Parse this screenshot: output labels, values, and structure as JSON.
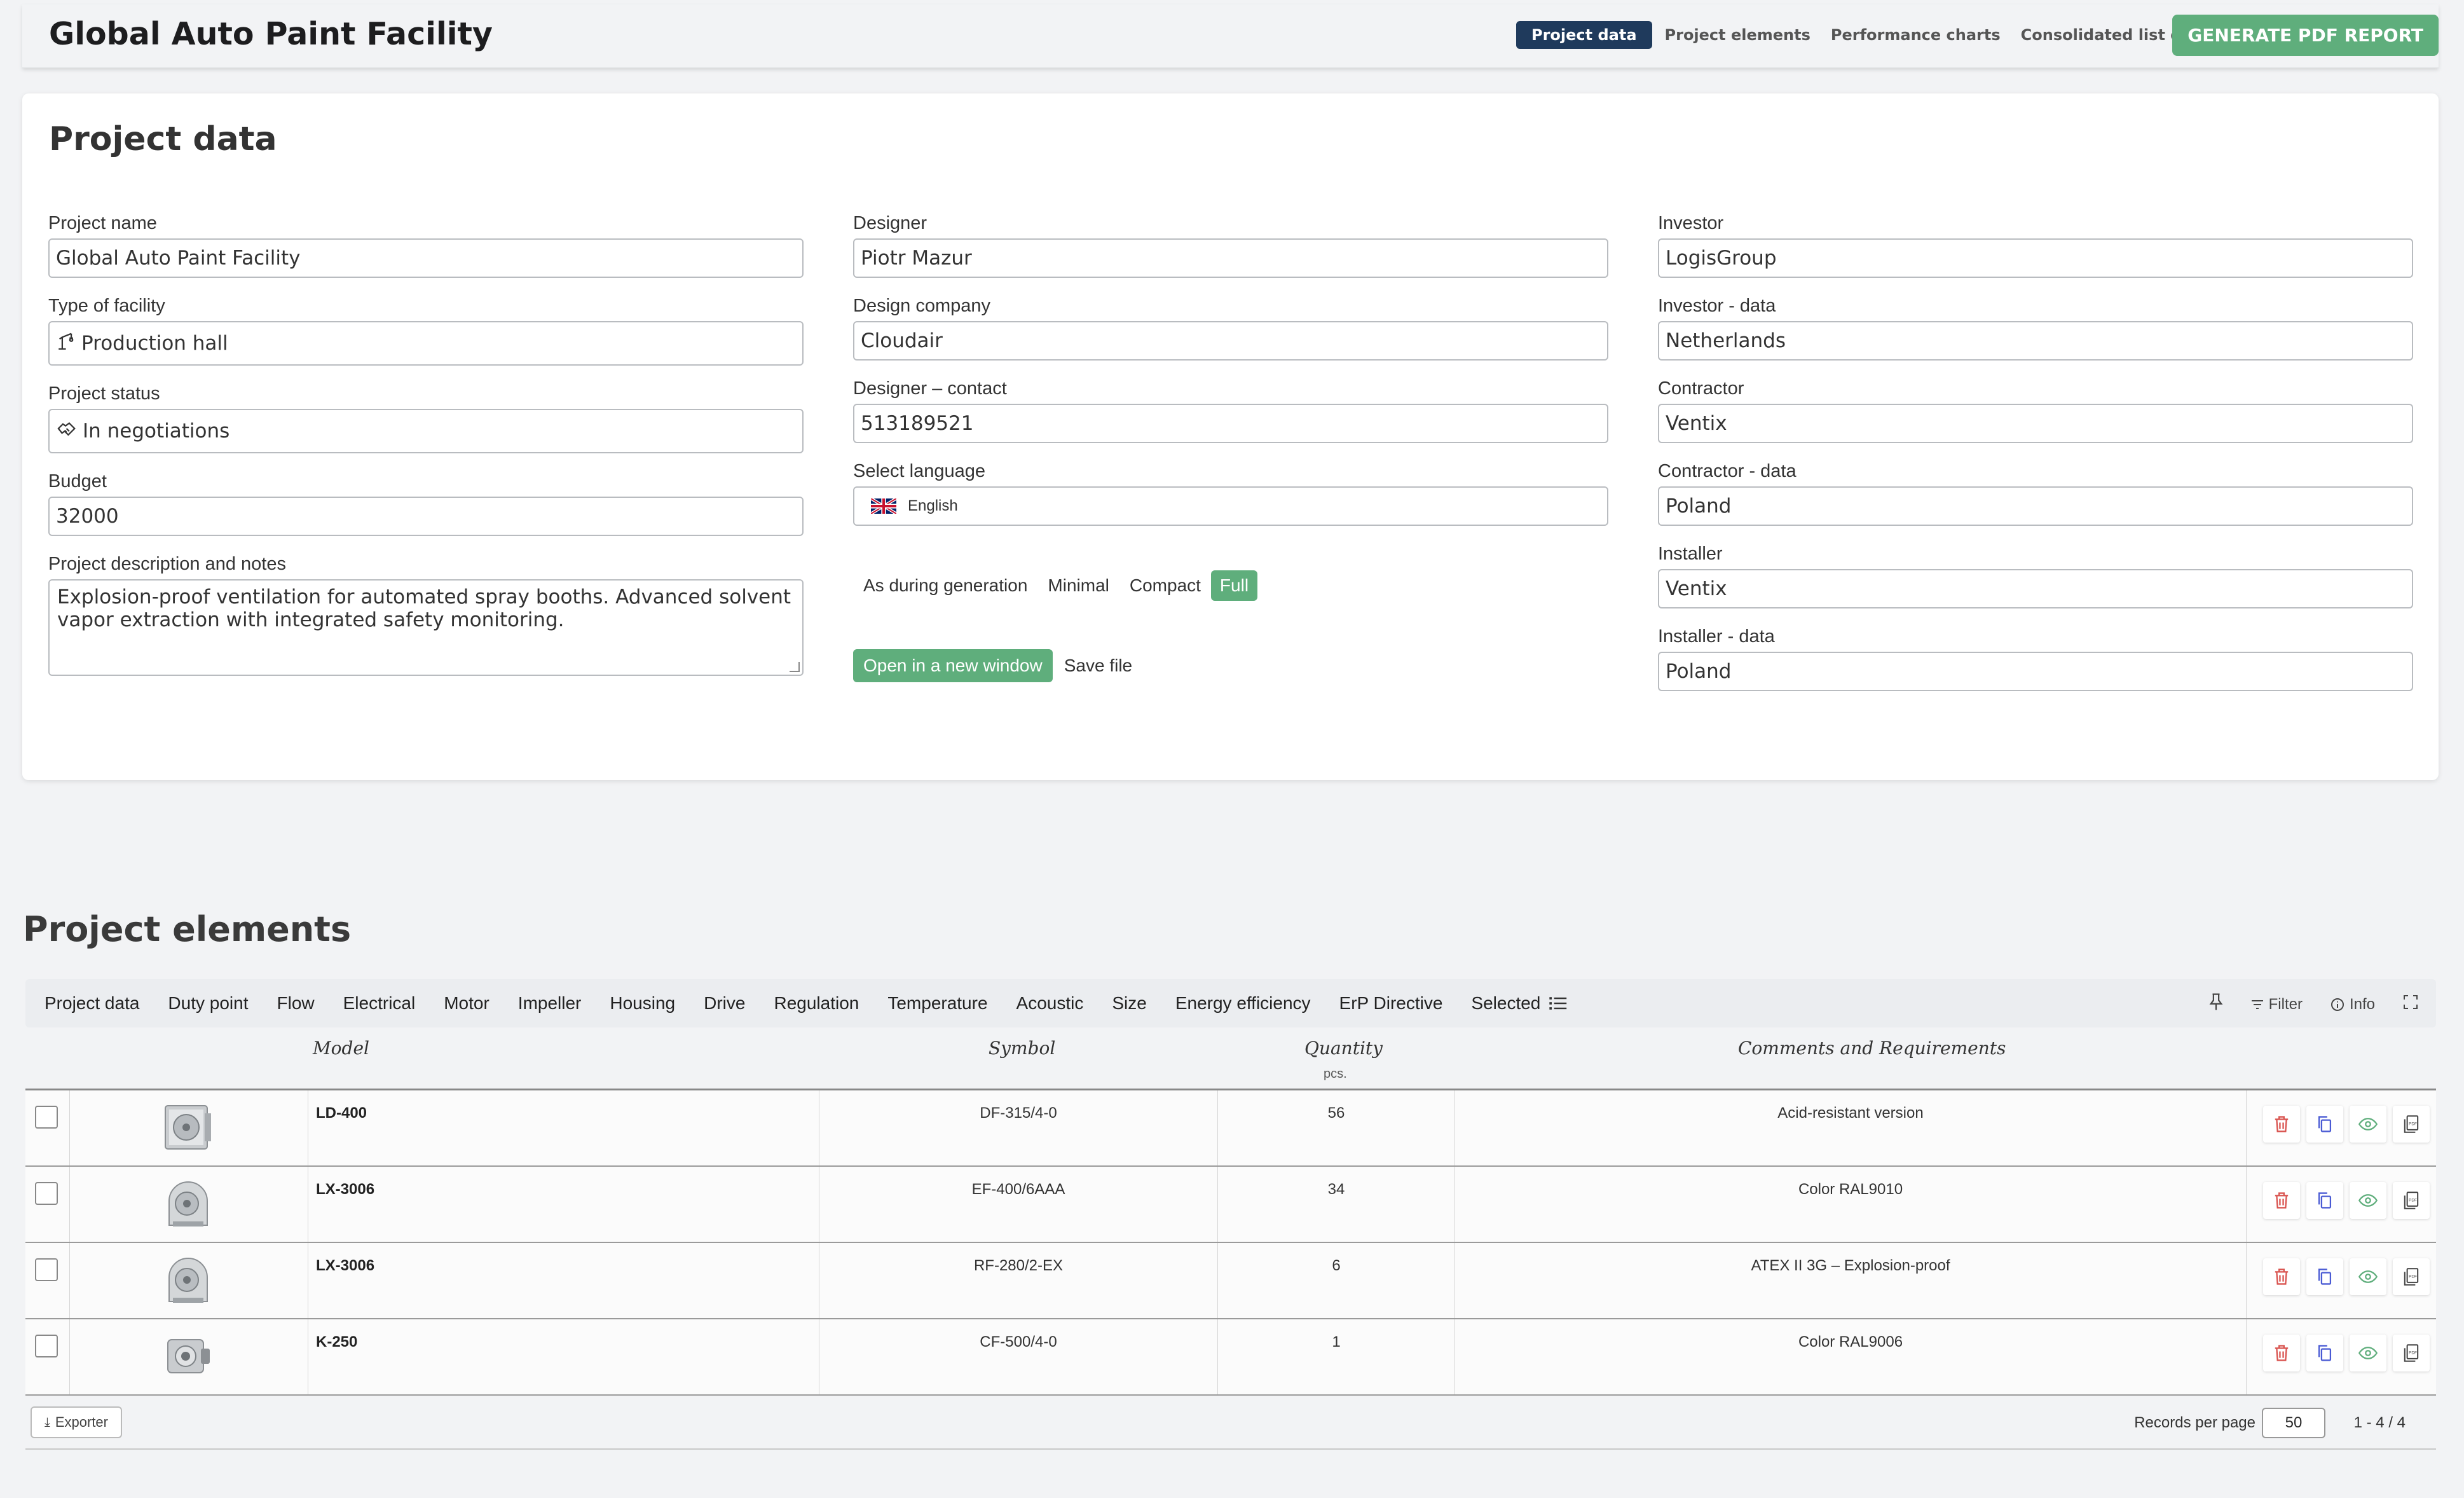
{
  "header": {
    "title": "Global Auto Paint Facility",
    "nav": [
      {
        "label": "Project data",
        "active": true
      },
      {
        "label": "Project elements",
        "active": false
      },
      {
        "label": "Performance charts",
        "active": false
      },
      {
        "label": "Consolidated list of products",
        "active": false
      }
    ],
    "generate_label": "GENERATE PDF REPORT"
  },
  "project": {
    "title": "Project data",
    "name_label": "Project name",
    "name_value": "Global Auto Paint Facility",
    "facility_label": "Type of facility",
    "facility_value": "Production hall",
    "status_label": "Project status",
    "status_value": "In negotiations",
    "budget_label": "Budget",
    "budget_value": "32000",
    "desc_label": "Project description and notes",
    "desc_value": "Explosion-proof ventilation for automated spray booths. Advanced solvent vapor extraction with integrated safety monitoring.",
    "designer_label": "Designer",
    "designer_value": "Piotr Mazur",
    "company_label": "Design company",
    "company_value": "Cloudair",
    "contact_label": "Designer – contact",
    "contact_value": "513189521",
    "language_label": "Select language",
    "language_value": "English",
    "modes": [
      "As during generation",
      "Minimal",
      "Compact",
      "Full"
    ],
    "mode_active": "Full",
    "open_label": "Open in a new window",
    "save_label": "Save file",
    "investor_label": "Investor",
    "investor_value": "LogisGroup",
    "investor_data_label": "Investor - data",
    "investor_data_value": "Netherlands",
    "contractor_label": "Contractor",
    "contractor_value": "Ventix",
    "contractor_data_label": "Contractor - data",
    "contractor_data_value": "Poland",
    "installer_label": "Installer",
    "installer_value": "Ventix",
    "installer_data_label": "Installer - data",
    "installer_data_value": "Poland"
  },
  "elements": {
    "title": "Project elements",
    "tabs": [
      "Project data",
      "Duty point",
      "Flow",
      "Electrical",
      "Motor",
      "Impeller",
      "Housing",
      "Drive",
      "Regulation",
      "Temperature",
      "Acoustic",
      "Size",
      "Energy efficiency",
      "ErP Directive",
      "Selected"
    ],
    "tools": {
      "filter": "Filter",
      "info": "Info"
    },
    "columns": {
      "model": "Model",
      "symbol": "Symbol",
      "quantity": "Quantity",
      "quantity_unit": "pcs.",
      "comments": "Comments and Requirements"
    },
    "rows": [
      {
        "model": "LD-400",
        "symbol": "DF-315/4-0",
        "quantity": "56",
        "comment": "Acid-resistant version"
      },
      {
        "model": "LX-3006",
        "symbol": "EF-400/6AAA",
        "quantity": "34",
        "comment": "Color RAL9010"
      },
      {
        "model": "LX-3006",
        "symbol": "RF-280/2-EX",
        "quantity": "6",
        "comment": "ATEX II 3G – Explosion-proof"
      },
      {
        "model": "K-250",
        "symbol": "CF-500/4-0",
        "quantity": "1",
        "comment": "Color RAL9006"
      }
    ],
    "footer": {
      "exporter": "Exporter",
      "records_label": "Records per page",
      "records_value": "50",
      "pager": "1 - 4 / 4"
    }
  },
  "colors": {
    "accent_green": "#5fae7c",
    "nav_active": "#1f3a5c",
    "delete_red": "#d9534f",
    "copy_blue": "#4a5bd4",
    "view_green": "#5fae7c"
  }
}
